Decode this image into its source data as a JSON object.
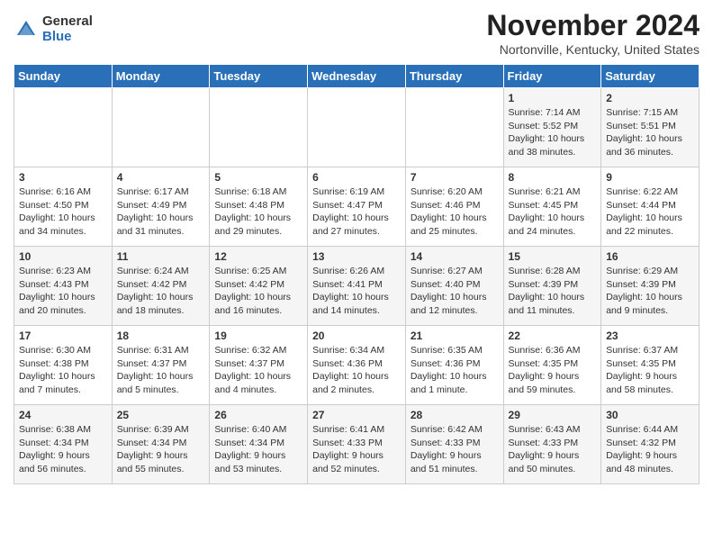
{
  "header": {
    "logo_general": "General",
    "logo_blue": "Blue",
    "title": "November 2024",
    "location": "Nortonville, Kentucky, United States"
  },
  "days_of_week": [
    "Sunday",
    "Monday",
    "Tuesday",
    "Wednesday",
    "Thursday",
    "Friday",
    "Saturday"
  ],
  "weeks": [
    [
      {
        "day": "",
        "info": ""
      },
      {
        "day": "",
        "info": ""
      },
      {
        "day": "",
        "info": ""
      },
      {
        "day": "",
        "info": ""
      },
      {
        "day": "",
        "info": ""
      },
      {
        "day": "1",
        "info": "Sunrise: 7:14 AM\nSunset: 5:52 PM\nDaylight: 10 hours and 38 minutes."
      },
      {
        "day": "2",
        "info": "Sunrise: 7:15 AM\nSunset: 5:51 PM\nDaylight: 10 hours and 36 minutes."
      }
    ],
    [
      {
        "day": "3",
        "info": "Sunrise: 6:16 AM\nSunset: 4:50 PM\nDaylight: 10 hours and 34 minutes."
      },
      {
        "day": "4",
        "info": "Sunrise: 6:17 AM\nSunset: 4:49 PM\nDaylight: 10 hours and 31 minutes."
      },
      {
        "day": "5",
        "info": "Sunrise: 6:18 AM\nSunset: 4:48 PM\nDaylight: 10 hours and 29 minutes."
      },
      {
        "day": "6",
        "info": "Sunrise: 6:19 AM\nSunset: 4:47 PM\nDaylight: 10 hours and 27 minutes."
      },
      {
        "day": "7",
        "info": "Sunrise: 6:20 AM\nSunset: 4:46 PM\nDaylight: 10 hours and 25 minutes."
      },
      {
        "day": "8",
        "info": "Sunrise: 6:21 AM\nSunset: 4:45 PM\nDaylight: 10 hours and 24 minutes."
      },
      {
        "day": "9",
        "info": "Sunrise: 6:22 AM\nSunset: 4:44 PM\nDaylight: 10 hours and 22 minutes."
      }
    ],
    [
      {
        "day": "10",
        "info": "Sunrise: 6:23 AM\nSunset: 4:43 PM\nDaylight: 10 hours and 20 minutes."
      },
      {
        "day": "11",
        "info": "Sunrise: 6:24 AM\nSunset: 4:42 PM\nDaylight: 10 hours and 18 minutes."
      },
      {
        "day": "12",
        "info": "Sunrise: 6:25 AM\nSunset: 4:42 PM\nDaylight: 10 hours and 16 minutes."
      },
      {
        "day": "13",
        "info": "Sunrise: 6:26 AM\nSunset: 4:41 PM\nDaylight: 10 hours and 14 minutes."
      },
      {
        "day": "14",
        "info": "Sunrise: 6:27 AM\nSunset: 4:40 PM\nDaylight: 10 hours and 12 minutes."
      },
      {
        "day": "15",
        "info": "Sunrise: 6:28 AM\nSunset: 4:39 PM\nDaylight: 10 hours and 11 minutes."
      },
      {
        "day": "16",
        "info": "Sunrise: 6:29 AM\nSunset: 4:39 PM\nDaylight: 10 hours and 9 minutes."
      }
    ],
    [
      {
        "day": "17",
        "info": "Sunrise: 6:30 AM\nSunset: 4:38 PM\nDaylight: 10 hours and 7 minutes."
      },
      {
        "day": "18",
        "info": "Sunrise: 6:31 AM\nSunset: 4:37 PM\nDaylight: 10 hours and 5 minutes."
      },
      {
        "day": "19",
        "info": "Sunrise: 6:32 AM\nSunset: 4:37 PM\nDaylight: 10 hours and 4 minutes."
      },
      {
        "day": "20",
        "info": "Sunrise: 6:34 AM\nSunset: 4:36 PM\nDaylight: 10 hours and 2 minutes."
      },
      {
        "day": "21",
        "info": "Sunrise: 6:35 AM\nSunset: 4:36 PM\nDaylight: 10 hours and 1 minute."
      },
      {
        "day": "22",
        "info": "Sunrise: 6:36 AM\nSunset: 4:35 PM\nDaylight: 9 hours and 59 minutes."
      },
      {
        "day": "23",
        "info": "Sunrise: 6:37 AM\nSunset: 4:35 PM\nDaylight: 9 hours and 58 minutes."
      }
    ],
    [
      {
        "day": "24",
        "info": "Sunrise: 6:38 AM\nSunset: 4:34 PM\nDaylight: 9 hours and 56 minutes."
      },
      {
        "day": "25",
        "info": "Sunrise: 6:39 AM\nSunset: 4:34 PM\nDaylight: 9 hours and 55 minutes."
      },
      {
        "day": "26",
        "info": "Sunrise: 6:40 AM\nSunset: 4:34 PM\nDaylight: 9 hours and 53 minutes."
      },
      {
        "day": "27",
        "info": "Sunrise: 6:41 AM\nSunset: 4:33 PM\nDaylight: 9 hours and 52 minutes."
      },
      {
        "day": "28",
        "info": "Sunrise: 6:42 AM\nSunset: 4:33 PM\nDaylight: 9 hours and 51 minutes."
      },
      {
        "day": "29",
        "info": "Sunrise: 6:43 AM\nSunset: 4:33 PM\nDaylight: 9 hours and 50 minutes."
      },
      {
        "day": "30",
        "info": "Sunrise: 6:44 AM\nSunset: 4:32 PM\nDaylight: 9 hours and 48 minutes."
      }
    ]
  ]
}
